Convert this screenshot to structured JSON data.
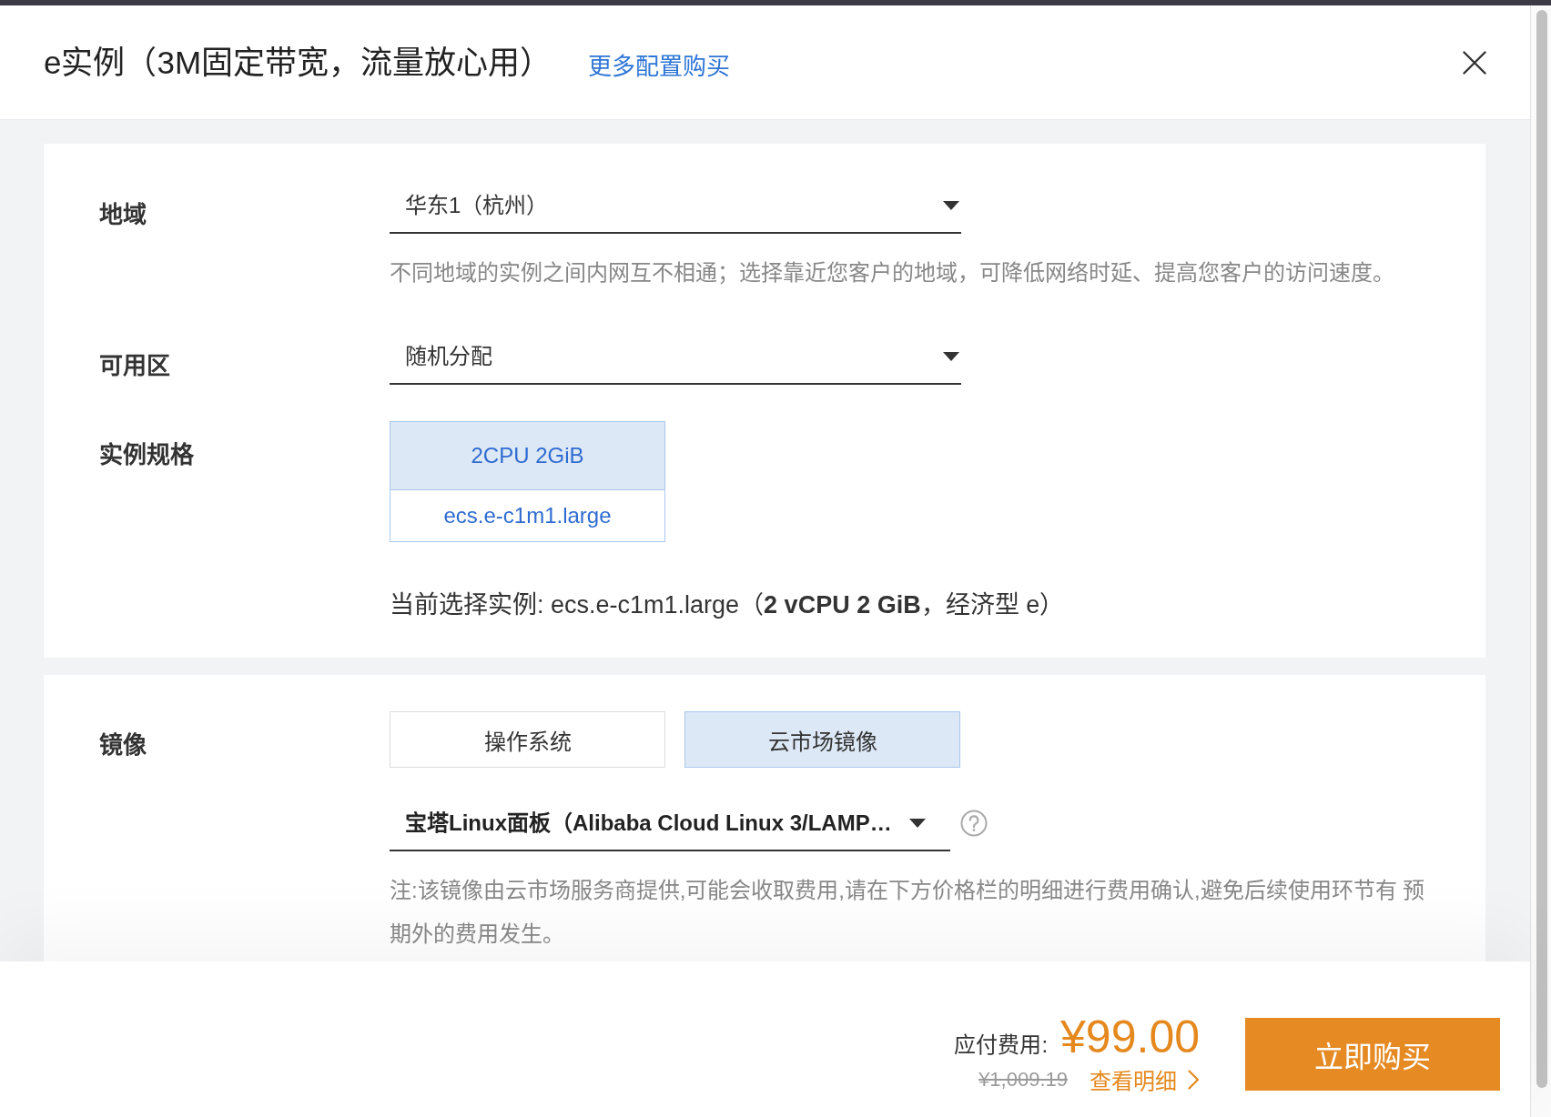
{
  "dialog": {
    "title": "e实例（3M固定带宽，流量放心用）",
    "link": "更多配置购买"
  },
  "sections": [
    {
      "fields": [
        {
          "kind": "select",
          "label": "地域",
          "value": "华东1（杭州）",
          "hint": "不同地域的实例之间内网互不相通；选择靠近您客户的地域，可降低网络时延、提高您客户的访问速度。"
        },
        {
          "kind": "select",
          "label": "可用区",
          "value": "随机分配"
        },
        {
          "kind": "spec",
          "label": "实例规格",
          "options": [
            {
              "title": "2CPU 2GiB",
              "code": "ecs.e-c1m1.large",
              "selected": true
            }
          ],
          "current": "当前选择实例: ecs.e-c1m1.large（**2 vCPU 2 GiB**，经济型 e）"
        }
      ]
    },
    {
      "fields": [
        {
          "kind": "tabs",
          "label": "镜像",
          "tabs": [
            {
              "label": "操作系统",
              "selected": false
            },
            {
              "label": "云市场镜像",
              "selected": true
            }
          ]
        },
        {
          "kind": "image_select",
          "value": "宝塔Linux面板（Alibaba Cloud Linux 3/LAMP…",
          "help": true,
          "hint": "注:该镜像由云市场服务商提供,可能会收取费用,请在下方价格栏的明细进行费用确认,避免后续使用环节有 预期外的费用发生。"
        }
      ]
    }
  ],
  "footer": {
    "price_label": "应付费用:",
    "price": "¥99.00",
    "original_price": "¥1,009.19",
    "details_link": "查看明细",
    "buy_button": "立即购买"
  }
}
